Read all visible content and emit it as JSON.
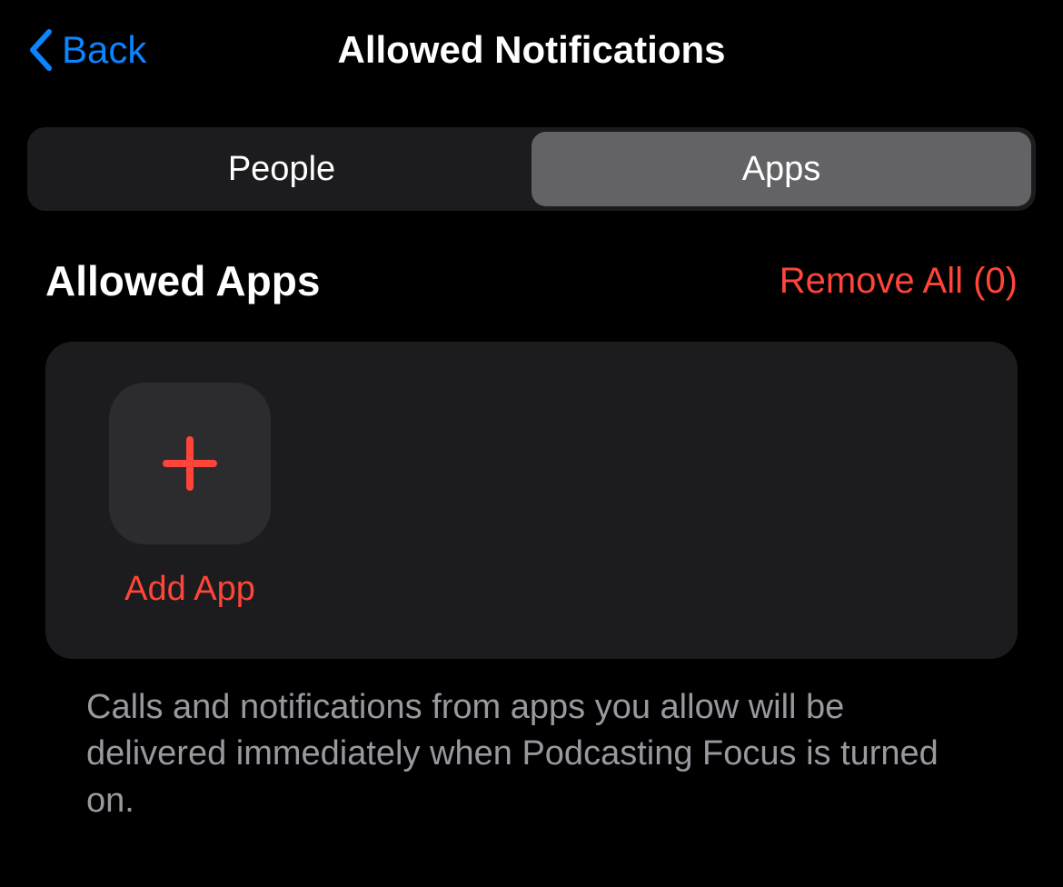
{
  "header": {
    "back_label": "Back",
    "title": "Allowed Notifications"
  },
  "segments": {
    "people": "People",
    "apps": "Apps"
  },
  "section": {
    "title": "Allowed Apps",
    "remove_all": "Remove All (0)"
  },
  "add_app": {
    "label": "Add App"
  },
  "description": "Calls and notifications from apps you allow will be delivered immediately when Podcasting Focus is turned on."
}
